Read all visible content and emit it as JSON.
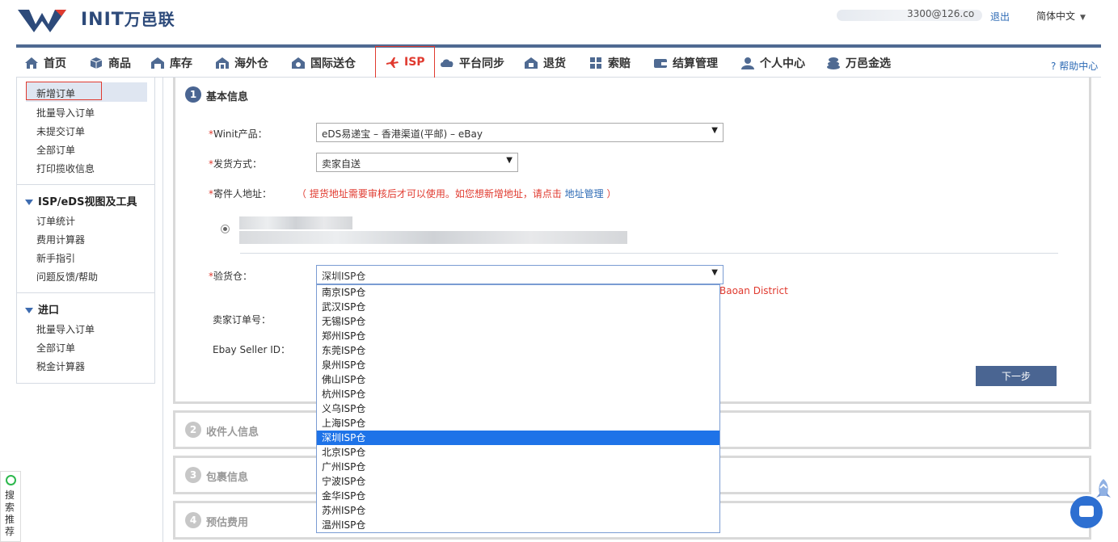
{
  "header": {
    "logo_text": "INIT",
    "logo_cn": "万邑联",
    "user_email": "3300@126.co",
    "logout": "退出",
    "language": "简体中文"
  },
  "nav": {
    "items": [
      {
        "label": "首页",
        "icon": "home-icon"
      },
      {
        "label": "商品",
        "icon": "cube-icon"
      },
      {
        "label": "库存",
        "icon": "warehouse-icon"
      },
      {
        "label": "海外仓",
        "icon": "overseas-warehouse-icon"
      },
      {
        "label": "国际送仓",
        "icon": "international-delivery-icon"
      },
      {
        "label": "ISP",
        "icon": "plane-icon"
      },
      {
        "label": "平台同步",
        "icon": "cloud-sync-icon"
      },
      {
        "label": "退货",
        "icon": "return-icon"
      },
      {
        "label": "索赔",
        "icon": "grid-icon"
      },
      {
        "label": "结算管理",
        "icon": "wallet-icon"
      },
      {
        "label": "个人中心",
        "icon": "person-icon"
      },
      {
        "label": "万邑金选",
        "icon": "coins-icon"
      }
    ],
    "help": "帮助中心"
  },
  "sidebar": {
    "group1": [
      "新增订单",
      "批量导入订单",
      "未提交订单",
      "全部订单",
      "打印揽收信息"
    ],
    "group2_title": "ISP/eDS视图及工具",
    "group2": [
      "订单统计",
      "费用计算器",
      "新手指引",
      "问题反馈/帮助"
    ],
    "group3_title": "进口",
    "group3": [
      "批量导入订单",
      "全部订单",
      "税金计算器"
    ]
  },
  "form": {
    "step1_num": "1",
    "step1_title": "基本信息",
    "product_label": "Winit产品：",
    "product_value": "eDS易递宝 – 香港渠道(平邮) – eBay",
    "shipping_label": "发货方式：",
    "shipping_value": "卖家自送",
    "sender_label": "寄件人地址：",
    "sender_note": "（ 提货地址需要审核后才可以使用。如您想新增地址，请点击",
    "sender_link": "地址管理",
    "sender_note_end": "）",
    "warehouse_label": "验货仓：",
    "warehouse_value": "深圳ISP仓",
    "warehouse_addr_partial": "Baoan District",
    "seller_order_label": "卖家订单号：",
    "ebay_seller_label": "Ebay Seller ID：",
    "next_button": "下一步",
    "required_mark": "*"
  },
  "dropdown_options": [
    "南京ISP仓",
    "武汉ISP仓",
    "无锡ISP仓",
    "郑州ISP仓",
    "东莞ISP仓",
    "泉州ISP仓",
    "佛山ISP仓",
    "杭州ISP仓",
    "义乌ISP仓",
    "上海ISP仓",
    "深圳ISP仓",
    "北京ISP仓",
    "广州ISP仓",
    "宁波ISP仓",
    "金华ISP仓",
    "苏州ISP仓",
    "温州ISP仓"
  ],
  "dropdown_selected": "深圳ISP仓",
  "steps": [
    {
      "num": "2",
      "title": "收件人信息"
    },
    {
      "num": "3",
      "title": "包裹信息"
    },
    {
      "num": "4",
      "title": "预估费用"
    }
  ],
  "left_tab": {
    "label": "搜索推荐"
  },
  "colors": {
    "accent_blue": "#4a6592",
    "nav_border": "#4f6a92",
    "active_red": "#e03a2f",
    "link_blue": "#2e6bb5",
    "selected_option": "#1e73e8"
  }
}
